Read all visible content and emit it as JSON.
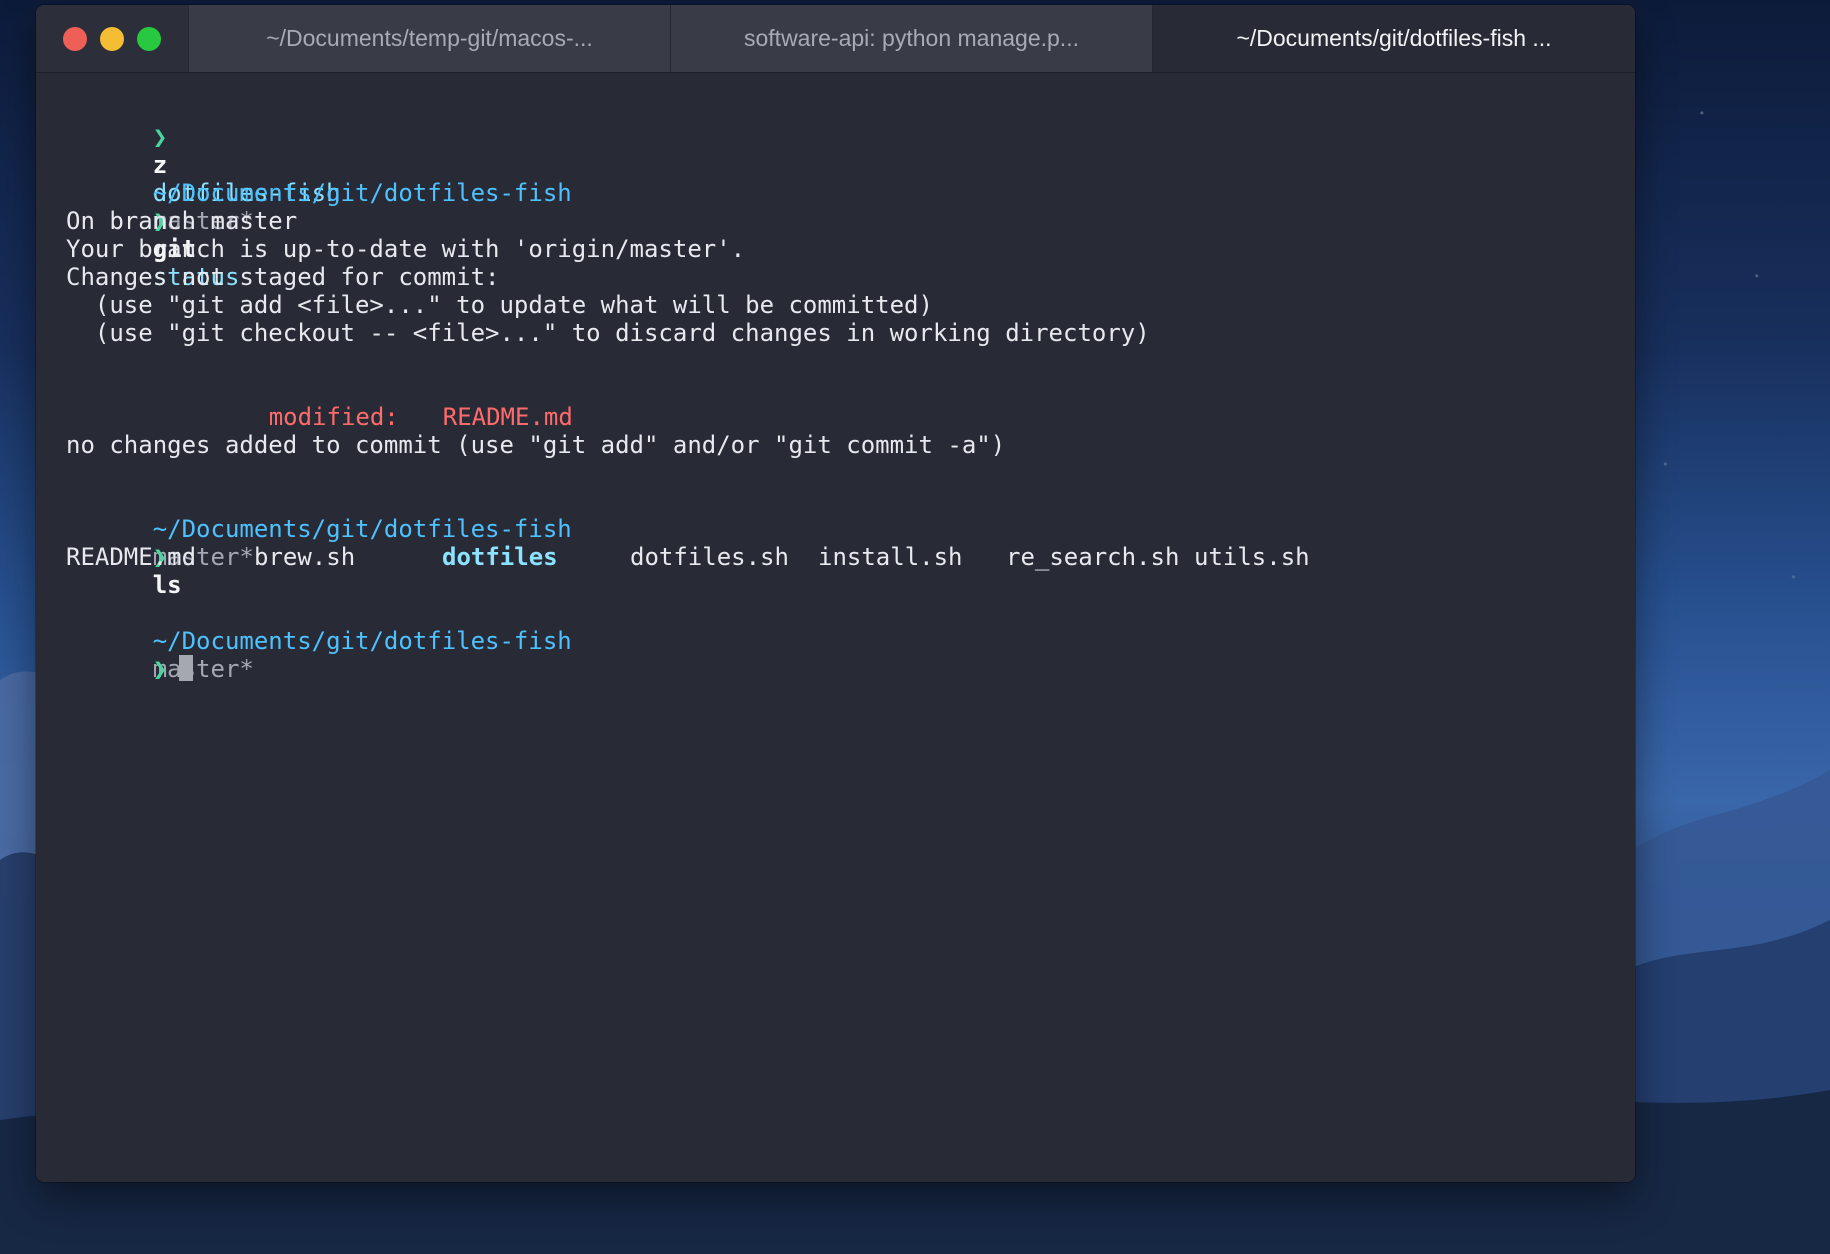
{
  "tabs": [
    {
      "label": "~/Documents/temp-git/macos-...",
      "active": false
    },
    {
      "label": "software-api: python manage.p...",
      "active": false
    },
    {
      "label": "~/Documents/git/dotfiles-fish ...",
      "active": true
    }
  ],
  "terminal": {
    "prompt_symbol": "❯",
    "cmd1": {
      "name": "z",
      "arg": "dotfiles-fish"
    },
    "path": "~/Documents/git/dotfiles-fish",
    "branch": "master*",
    "cmd2": {
      "name": "git",
      "arg": "status"
    },
    "status_lines": [
      "On branch master",
      "Your branch is up-to-date with 'origin/master'.",
      "Changes not staged for commit:",
      "  (use \"git add <file>...\" to update what will be committed)",
      "  (use \"git checkout -- <file>...\" to discard changes in working directory)"
    ],
    "modified_label": "modified:",
    "modified_file": "README.md",
    "no_changes_line": "no changes added to commit (use \"git add\" and/or \"git commit -a\")",
    "cmd3": {
      "name": "ls"
    },
    "ls_items": [
      "README.md",
      "brew.sh",
      "dotfiles",
      "dotfiles.sh",
      "install.sh",
      "re_search.sh",
      "utils.sh"
    ]
  },
  "colors": {
    "path": "#4ec1ff",
    "prompt": "#48d7a0",
    "modified": "#ff6b6b",
    "terminal_bg": "#282b36"
  },
  "icons": [
    "close-dot-icon",
    "minimize-dot-icon",
    "zoom-dot-icon"
  ]
}
